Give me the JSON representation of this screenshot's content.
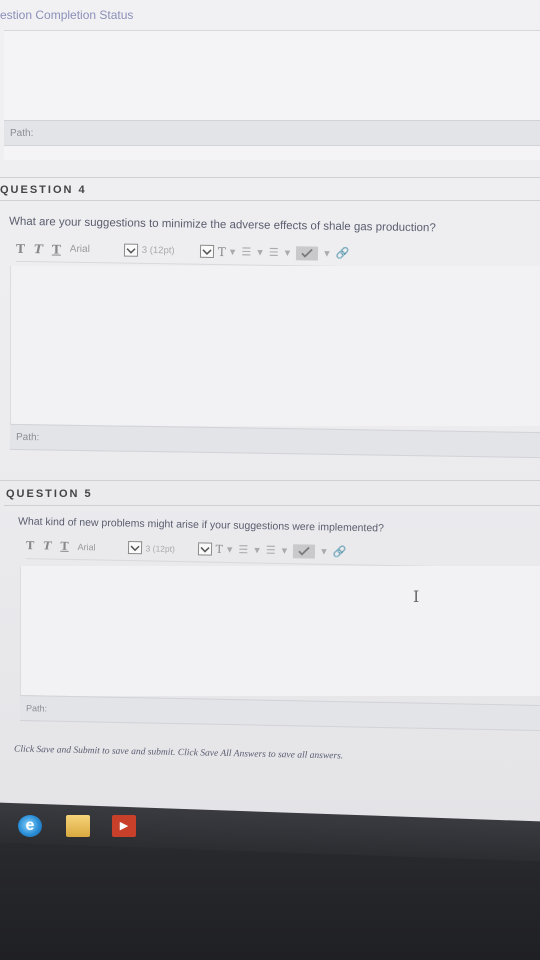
{
  "status": {
    "title": "estion Completion Status"
  },
  "top": {
    "path_label": "Path:"
  },
  "questions": [
    {
      "header": "QUESTION 4",
      "text": "What are your suggestions to minimize the adverse effects of shale gas production?",
      "font": "Arial",
      "size": "3 (12pt)",
      "path_label": "Path:"
    },
    {
      "header": "QUESTION 5",
      "text": "What kind of new problems might arise if your suggestions were implemented?",
      "font": "Arial",
      "size": "3 (12pt)",
      "path_label": "Path:"
    }
  ],
  "toolbar": {
    "bold": "T",
    "italic": "T",
    "underline": "T",
    "text_color": "T"
  },
  "footer": {
    "hint": "Click Save and Submit to save and submit. Click Save All Answers to save all answers."
  },
  "taskbar": {
    "ie_label": "e"
  }
}
